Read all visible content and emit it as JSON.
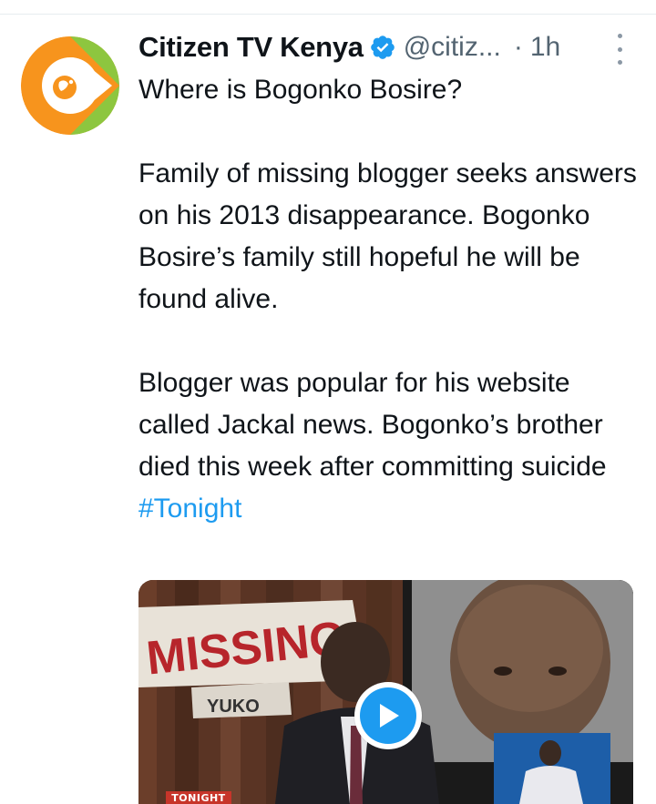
{
  "tweet": {
    "display_name": "Citizen TV Kenya",
    "handle": "@citiz...",
    "separator": "·",
    "time": "1h",
    "text_main": "Where is Bogonko Bosire?\n\nFamily of missing blogger seeks answers on his 2013 disappearance. Bogonko Bosire’s family still hopeful he will be found alive.\n\nBlogger was popular for his website called Jackal news. Bogonko’s brother died this week after committing suicide ",
    "hashtag": "#Tonight"
  },
  "media": {
    "overlay_missing": "MISSING",
    "overlay_yuko": "YUKO",
    "overlay_tonight": "TONIGHT"
  },
  "icons": {
    "avatar": "citizen-tv-logo",
    "verified": "verified-badge-icon",
    "more": "more-options-icon",
    "play": "play-icon"
  },
  "colors": {
    "link_blue": "#1d9bf0",
    "muted_gray": "#536471",
    "logo_orange": "#f7941d",
    "logo_green": "#8dc63f"
  }
}
